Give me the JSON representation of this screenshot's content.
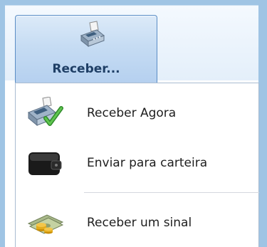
{
  "ribbon": {
    "button_label": "Receber...",
    "button_icon": "cash-register-icon"
  },
  "menu": {
    "items": [
      {
        "label": "Receber Agora",
        "icon": "cash-register-check-icon"
      },
      {
        "label": "Enviar para carteira",
        "icon": "wallet-icon"
      },
      {
        "label": "Receber um sinal",
        "icon": "money-coins-icon"
      }
    ]
  },
  "colors": {
    "button_border": "#5b8dc5",
    "button_text": "#1f3f66",
    "frame": "#9fc4e4"
  }
}
